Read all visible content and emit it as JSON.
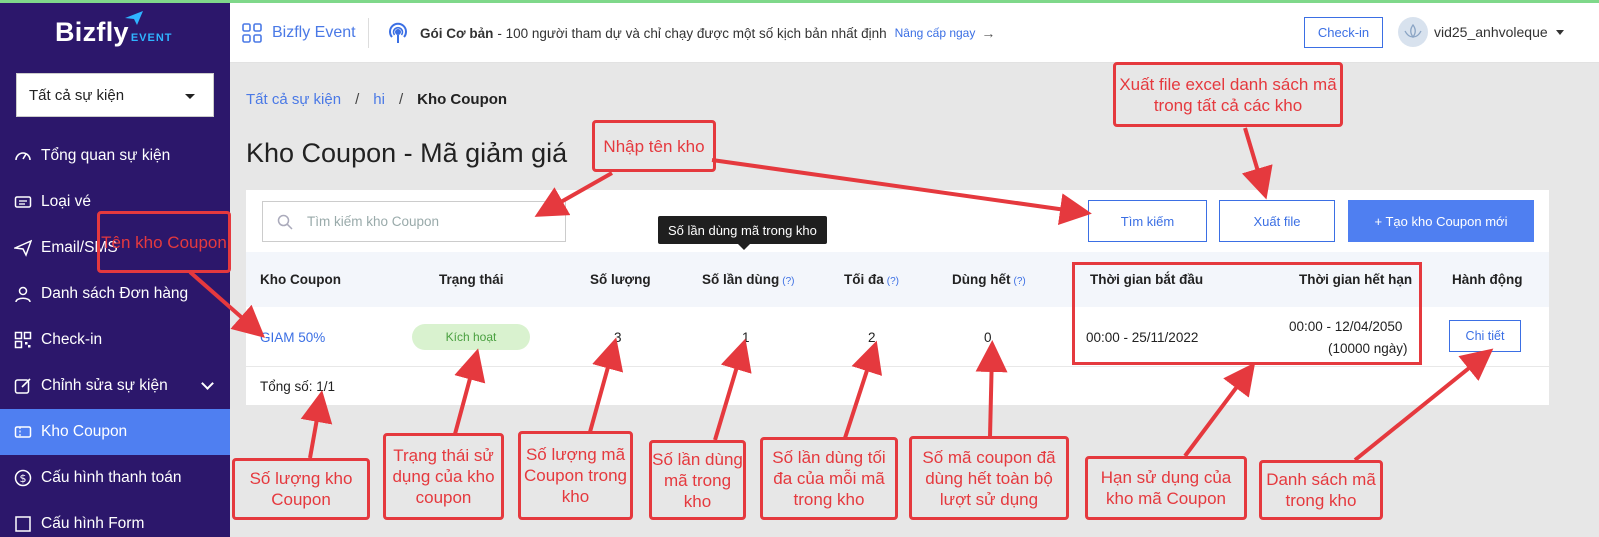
{
  "colors": {
    "sidebar": "#2c176b",
    "accent": "#4f7ff1",
    "annotation": "#e5393e",
    "badge_bg": "#d9f2cf"
  },
  "sidebar": {
    "logo_main": "Bizfly",
    "logo_sub": "EVENT",
    "event_select": "Tất cả sự kiện",
    "items": [
      {
        "label": "Tổng quan sự kiện",
        "icon": "gauge-icon"
      },
      {
        "label": "Loại vé",
        "icon": "ticket-icon"
      },
      {
        "label": "Email/SMS",
        "icon": "send-icon"
      },
      {
        "label": "Danh sách Đơn hàng",
        "icon": "user-icon"
      },
      {
        "label": "Check-in",
        "icon": "qr-icon"
      },
      {
        "label": "Chỉnh sửa sự kiện",
        "icon": "edit-icon"
      },
      {
        "label": "Kho Coupon",
        "icon": "coupon-icon"
      },
      {
        "label": "Cấu hình thanh toán",
        "icon": "dollar-icon"
      },
      {
        "label": "Cấu hình Form",
        "icon": "form-icon"
      }
    ]
  },
  "header": {
    "brand": "Bizfly Event",
    "plan_name": "Gói Cơ bản",
    "plan_desc": "- 100 người tham dự và chỉ chạy được một số kịch bản nhất định",
    "upgrade": "Nâng cấp ngay",
    "checkin": "Check-in",
    "username": "vid25_anhvoleque"
  },
  "breadcrumb": {
    "root": "Tất cả sự kiện",
    "event": "hi",
    "current": "Kho Coupon"
  },
  "page_title": "Kho Coupon - Mã giảm giá",
  "toolbar": {
    "search_placeholder": "Tìm kiếm kho Coupon",
    "search_button": "Tìm kiếm",
    "export_button": "Xuất file",
    "create_button": "+ Tạo kho Coupon mới"
  },
  "table": {
    "headers": {
      "name": "Kho Coupon",
      "status": "Trạng thái",
      "quantity": "Số lượng",
      "uses": "Số lần dùng",
      "max": "Tối đa",
      "used_up": "Dùng hết",
      "start": "Thời gian bắt đầu",
      "end": "Thời gian hết hạn",
      "action": "Hành động",
      "help": "(?)"
    },
    "rows": [
      {
        "name": "GIAM 50%",
        "status": "Kích hoạt",
        "quantity": "3",
        "uses": "1",
        "max": "2",
        "used_up": "0",
        "start": "00:00 - 25/11/2022",
        "end": "00:00 - 12/04/2050",
        "end_days": "(10000 ngày)",
        "action": "Chi tiết"
      }
    ],
    "total_label": "Tổng số:",
    "total_value": "1/1"
  },
  "tooltip": "Số lần dùng mã trong kho",
  "annotations": {
    "export": "Xuất file excel danh sách mã trong tất cả các kho",
    "name_input": "Nhập tên kho",
    "coupon_name": "Tên kho Coupon",
    "count": "Số lượng kho Coupon",
    "status": "Trạng thái sử dụng của kho coupon",
    "quantity": "Số lượng mã Coupon trong kho",
    "uses": "Số lần dùng mã trong kho",
    "max": "Số lần dùng tối đa của mỗi mã trong kho",
    "used_up": "Số mã coupon đã dùng hết toàn bộ lượt sử dụng",
    "validity": "Hạn sử dụng của kho mã Coupon",
    "list": "Danh sách mã trong kho"
  }
}
